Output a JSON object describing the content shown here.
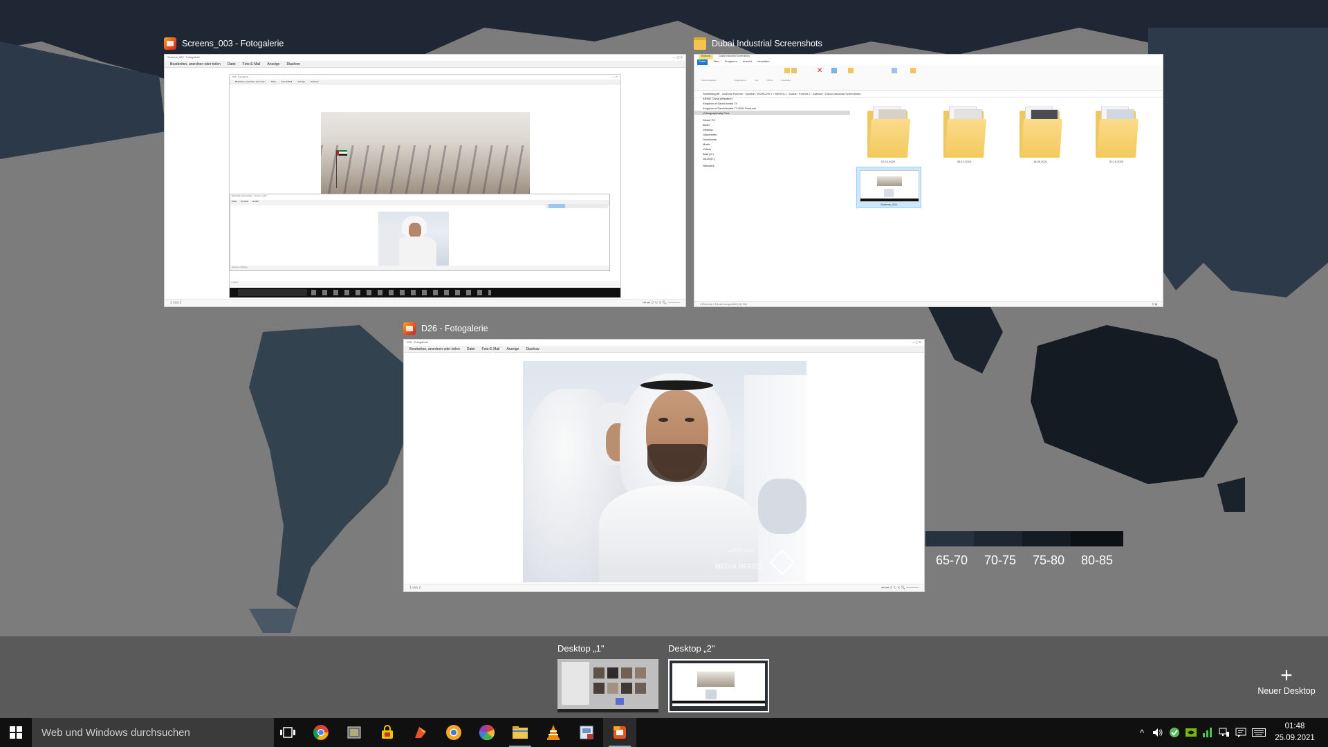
{
  "windows": [
    {
      "title": "Screens_003 - Fotogalerie",
      "app": "Fotogalerie"
    },
    {
      "title": "Dubai Industrial Screenshots",
      "app": "Explorer"
    },
    {
      "title": "D26 - Fotogalerie",
      "app": "Fotogalerie"
    }
  ],
  "gallery": {
    "menu": [
      "Bearbeiten, anordnen oder teilen",
      "Datei",
      "Foto-E-Mail",
      "Anzeige",
      "Diashow"
    ],
    "status": "1 von 2",
    "inner_status": "1 von 2"
  },
  "explorer": {
    "tabs": [
      "Datei",
      "Start",
      "Freigeben",
      "Ansicht",
      "Verwalten"
    ],
    "ribbon_context": "Bildtools",
    "ribbon_title": "Dubai Industrial Screenshots",
    "address": "Andreas Rumme › Sparkle › WORLD% 1 › WER20-1 › Dubai › Portrait 1 › Grafisch › Dubai Industrial Screenshots",
    "nav_items": [
      "Schnellzugriff",
      "ARINE China Afrikathen",
      "Kingdom of Saudi Arabia 74",
      "Kingdom of Saudi Arabia 77-2090 Products",
      "Videographically Post",
      "Dieser PC",
      "Bilder",
      "Desktop",
      "Dokumente",
      "Downloads",
      "Musik",
      "Videos",
      "Arial (C:)",
      "DATA (E:)",
      "Netzwerk"
    ],
    "folders": [
      {
        "date": "02.10.2020"
      },
      {
        "date": "08.12.2020"
      },
      {
        "date": "18.06.2021"
      },
      {
        "date": "02.10.2020"
      }
    ],
    "selected_file": "Screens_003",
    "status": "5 Elemente    1 Element ausgewählt (149 KB)"
  },
  "map_legend": {
    "labels": [
      "65-70",
      "70-75",
      "75-80",
      "80-85"
    ],
    "colors": [
      "#273240",
      "#1d2631",
      "#151b23",
      "#0d1116"
    ]
  },
  "photo_watermark": {
    "brand": "MEDIA OFFICE",
    "arabic": "المكتب الإعلامي"
  },
  "desktops": [
    {
      "label": "Desktop „1\""
    },
    {
      "label": "Desktop „2\""
    }
  ],
  "new_desktop": "Neuer Desktop",
  "taskbar": {
    "search_placeholder": "Web und Windows durchsuchen",
    "apps": [
      "task-view-icon",
      "chrome-icon",
      "image-tool-icon",
      "vpn-icon",
      "paint-icon",
      "chrome-canary-icon",
      "picasa-icon",
      "file-explorer-icon",
      "vlc-icon",
      "pdf-viewer-icon",
      "photo-gallery-icon"
    ],
    "time": "01:48",
    "date": "25.09.2021"
  }
}
